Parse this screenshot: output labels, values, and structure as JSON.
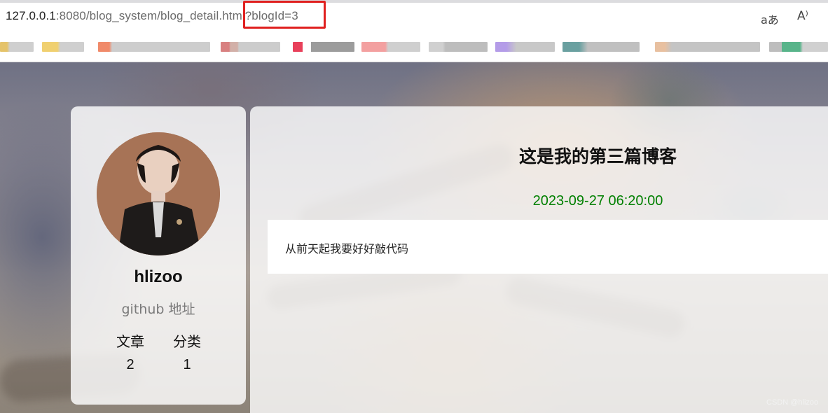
{
  "browser": {
    "url_host": "127.0.0.1",
    "url_rest": ":8080/blog_system/blog_detail.html?blogId=3",
    "read_icon": "aあ",
    "aloud_icon": "A⁾"
  },
  "bookmarks": [
    "bookmark-1",
    "bookmark-2",
    "bookmark-3",
    "bookmark-4",
    "bookmark-5",
    "bookmark-6",
    "bookmark-7",
    "bookmark-8",
    "bookmark-9",
    "bookmark-10",
    "bookmark-11",
    "bookmark-12"
  ],
  "profile": {
    "username": "hlizoo",
    "github_label": "github 地址",
    "stats": [
      {
        "label": "文章",
        "value": "2"
      },
      {
        "label": "分类",
        "value": "1"
      }
    ]
  },
  "blog": {
    "title": "这是我的第三篇博客",
    "date": "2023-09-27 06:20:00",
    "content": "从前天起我要好好敲代码"
  },
  "watermark": "CSDN @hlizoo",
  "colors": {
    "date_green": "#008000",
    "highlight_red": "#e0201f"
  }
}
